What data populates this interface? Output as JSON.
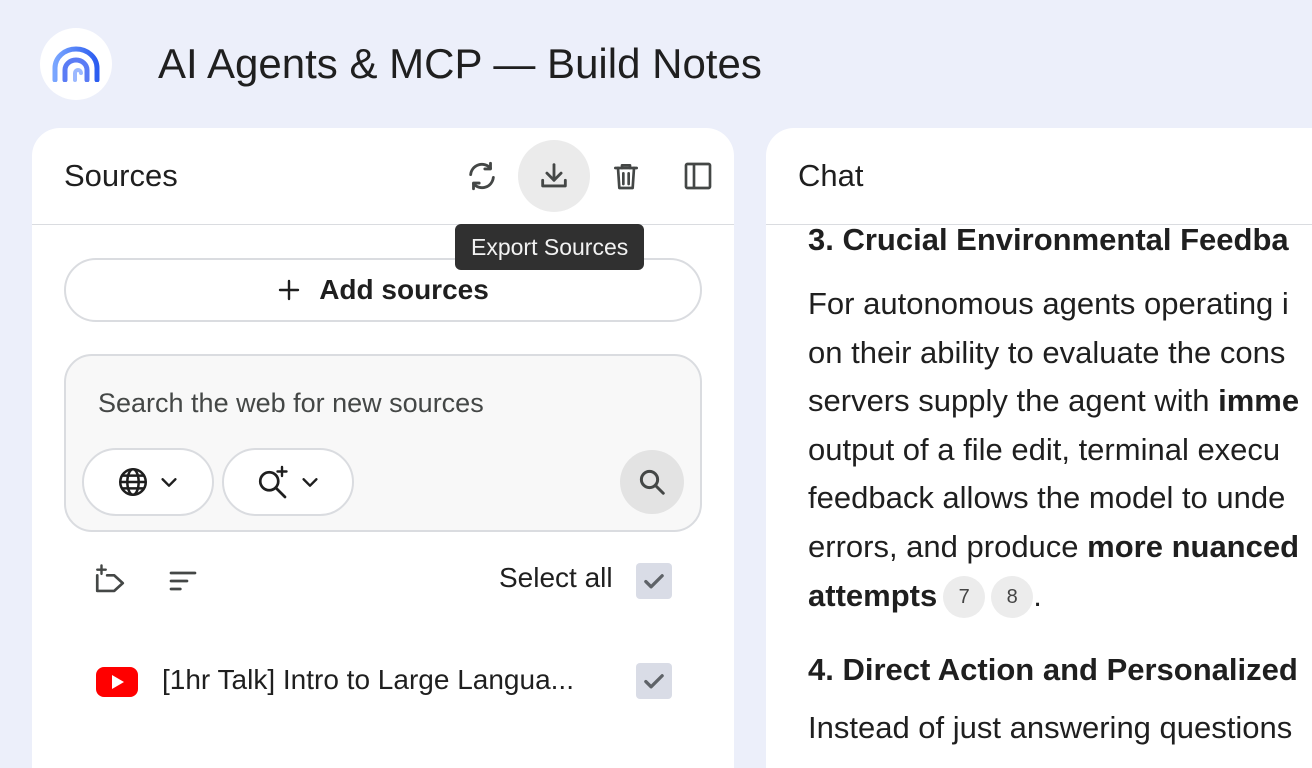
{
  "app": {
    "title": "AI Agents & MCP — Build Notes",
    "logo_icon": "rainbow-arc-logo"
  },
  "sources": {
    "title": "Sources",
    "header_icons": [
      "refresh-icon",
      "download-icon",
      "trash-icon",
      "panel-collapse-icon"
    ],
    "tooltip": "Export Sources",
    "add_label": "Add sources",
    "search": {
      "placeholder": "Search the web for new sources",
      "web_icon": "globe-icon",
      "mode_icon": "sparkle-search-icon",
      "go_icon": "search-icon"
    },
    "select_all_label": "Select all",
    "select_all_checked": true,
    "items": [
      {
        "title": "[1hr Talk] Intro to Large Langua...",
        "type_icon": "youtube-icon",
        "checked": true
      }
    ]
  },
  "chat": {
    "title": "Chat",
    "section3": {
      "heading": "3. Crucial Environmental Feedba",
      "line1": "For autonomous agents operating i",
      "line2": "on their ability to evaluate the cons",
      "line3_pre": "servers supply the agent with ",
      "line3_bold": "imme",
      "line4": "output of a file edit, terminal execu",
      "line5": "feedback allows the model to unde",
      "line6_pre": "errors, and produce ",
      "line6_bold": "more nuanced",
      "line7_bold": "attempts",
      "line7_end": ".",
      "citations": [
        "7",
        "8"
      ]
    },
    "section4": {
      "heading": "4. Direct Action and Personalized",
      "line1": "Instead of just answering questions"
    }
  },
  "colors": {
    "background": "#eceffa",
    "panel": "#ffffff",
    "tooltip_bg": "#303030",
    "youtube_red": "#ff0000",
    "checkbox_bg": "#d9dce6"
  }
}
